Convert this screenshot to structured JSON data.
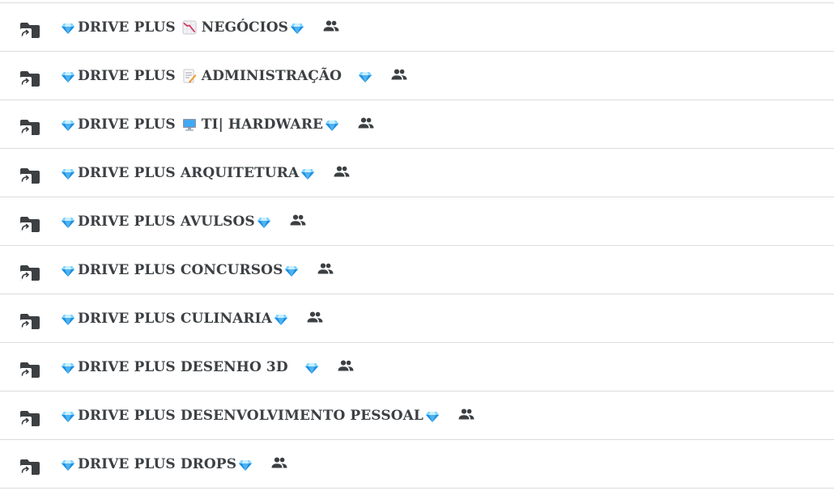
{
  "colors": {
    "text": "#3c4043",
    "divider": "#dcdcdc",
    "folder_icon": "#3c4043",
    "gem_light": "#7fd4ff",
    "gem_dark": "#1a8de0"
  },
  "folders": [
    {
      "prefix": "DRIVE PLUS",
      "emoji": "chart-decreasing-emoji",
      "title": "NEGÓCIOS",
      "gap_after_title": "small"
    },
    {
      "prefix": "DRIVE PLUS",
      "emoji": "memo-emoji",
      "title": "ADMINISTRAÇÃO",
      "gap_after_title": "large"
    },
    {
      "prefix": "DRIVE PLUS",
      "emoji": "desktop-computer-emoji",
      "title": "TI| HARDWARE",
      "gap_after_title": "small"
    },
    {
      "prefix": "DRIVE PLUS",
      "emoji": null,
      "title": "ARQUITETURA",
      "gap_after_title": "small"
    },
    {
      "prefix": "DRIVE PLUS",
      "emoji": null,
      "title": "AVULSOS",
      "gap_after_title": "small"
    },
    {
      "prefix": "DRIVE PLUS",
      "emoji": null,
      "title": "CONCURSOS",
      "gap_after_title": "small"
    },
    {
      "prefix": "DRIVE PLUS",
      "emoji": null,
      "title": "CULINARIA",
      "gap_after_title": "small"
    },
    {
      "prefix": "DRIVE PLUS",
      "emoji": null,
      "title": "DESENHO 3D",
      "gap_after_title": "large"
    },
    {
      "prefix": "DRIVE PLUS",
      "emoji": null,
      "title": "DESENVOLVIMENTO PESSOAL",
      "gap_after_title": "small"
    },
    {
      "prefix": "DRIVE PLUS",
      "emoji": null,
      "title": "DROPS",
      "gap_after_title": "small"
    }
  ],
  "icons": {
    "row_icon": "shared-folder-shortcut-icon",
    "decoration": "gem-stone-emoji",
    "sharing": "people-icon"
  }
}
